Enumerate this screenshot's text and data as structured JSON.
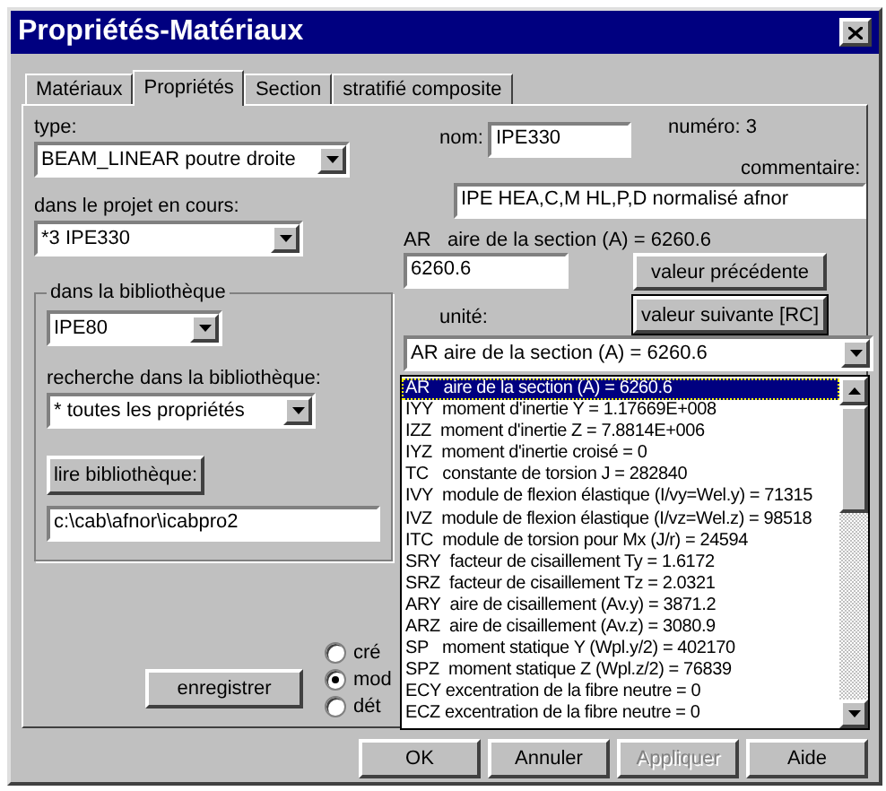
{
  "window": {
    "title": "Propriétés-Matériaux"
  },
  "tabs": [
    {
      "label": "Matériaux",
      "selected": false
    },
    {
      "label": "Propriétés",
      "selected": true
    },
    {
      "label": "Section",
      "selected": false
    },
    {
      "label": "stratifié composite",
      "selected": false
    }
  ],
  "left": {
    "type_label": "type:",
    "type_value": "BEAM_LINEAR poutre droite",
    "project_label": "dans le projet en cours:",
    "project_value": "*3 IPE330",
    "library": {
      "legend": "dans la bibliothèque",
      "section_value": "IPE80",
      "search_label": "recherche dans la bibliothèque:",
      "search_value": "* toutes les propriétés",
      "read_button": "lire bibliothèque:",
      "path_value": "c:\\cab\\afnor\\icabpro2"
    },
    "save_button": "enregistrer",
    "modes": [
      {
        "label": "cré",
        "selected": false
      },
      {
        "label": "mod",
        "selected": true
      },
      {
        "label": "dét",
        "selected": false
      }
    ]
  },
  "right": {
    "name_label": "nom:",
    "name_value": "IPE330",
    "number": "numéro:  3",
    "comment_label": "commentaire:",
    "comment_value": "IPE HEA,C,M HL,P,D normalisé afnor",
    "property_caption": "AR   aire de la section (A) = 6260.6",
    "property_value": "6260.6",
    "prev_button": "valeur précédente",
    "next_button": "valeur suivante [RC]",
    "unit_label": "unité:",
    "property_combo": "AR   aire de la section (A) = 6260.6",
    "property_list": [
      {
        "label": "AR   aire de la section (A) = 6260.6",
        "selected": true
      },
      {
        "label": "IYY  moment d'inertie Y = 1.17669E+008",
        "selected": false
      },
      {
        "label": "IZZ  moment d'inertie Z = 7.8814E+006",
        "selected": false
      },
      {
        "label": "IYZ  moment d'inertie croisé = 0",
        "selected": false
      },
      {
        "label": "TC   constante de torsion J = 282840",
        "selected": false
      },
      {
        "label": "IVY  module de flexion élastique (I/vy=Wel.y) = 71315",
        "selected": false
      },
      {
        "label": "IVZ  module de flexion élastique (I/vz=Wel.z) = 98518",
        "selected": false
      },
      {
        "label": "ITC  module de torsion pour Mx (J/r) = 24594",
        "selected": false
      },
      {
        "label": "SRY  facteur de cisaillement Ty = 1.6172",
        "selected": false
      },
      {
        "label": "SRZ  facteur de cisaillement Tz = 2.0321",
        "selected": false
      },
      {
        "label": "ARY  aire de cisaillement (Av.y) = 3871.2",
        "selected": false
      },
      {
        "label": "ARZ  aire de cisaillement (Av.z) = 3080.9",
        "selected": false
      },
      {
        "label": "SP   moment statique Y (Wpl.y/2) = 402170",
        "selected": false
      },
      {
        "label": "SPZ  moment statique Z (Wpl.z/2) = 76839",
        "selected": false
      },
      {
        "label": "ECY excentration de la fibre neutre = 0",
        "selected": false
      },
      {
        "label": "ECZ excentration de la fibre neutre = 0",
        "selected": false
      }
    ]
  },
  "buttons": [
    {
      "label": "OK",
      "disabled": false
    },
    {
      "label": "Annuler",
      "disabled": false
    },
    {
      "label": "Appliquer",
      "disabled": true
    },
    {
      "label": "Aide",
      "disabled": false
    }
  ]
}
